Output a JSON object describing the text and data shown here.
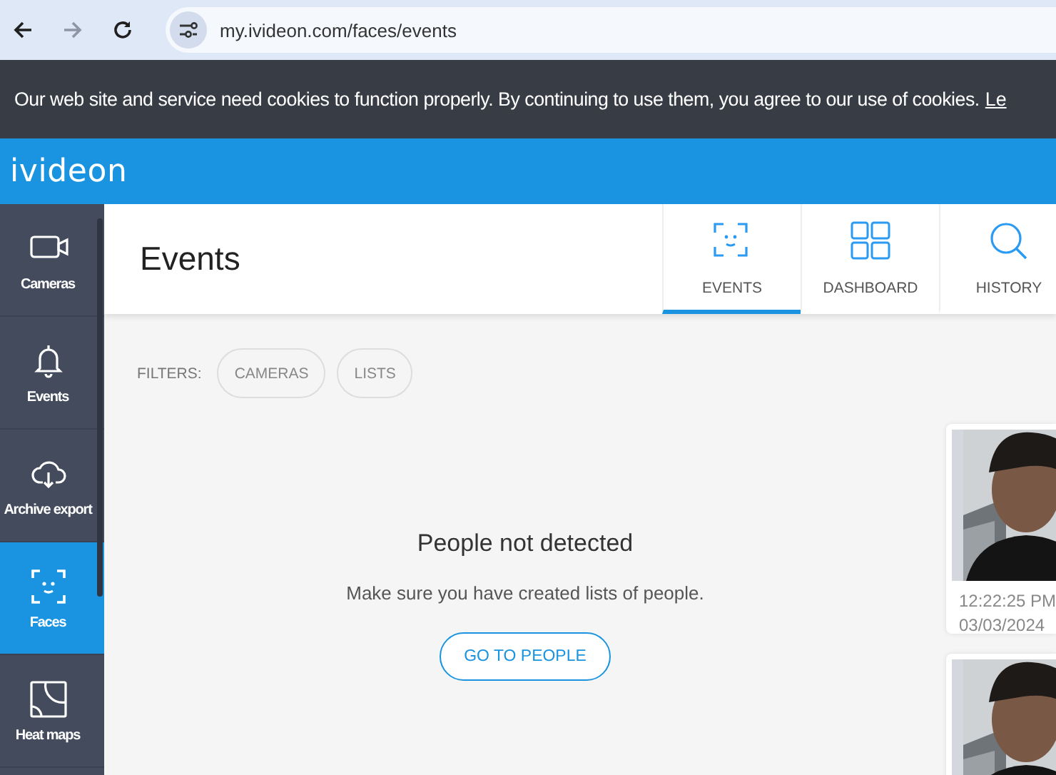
{
  "browser": {
    "url": "my.ivideon.com/faces/events",
    "back_disabled": false,
    "forward_disabled": true
  },
  "cookie_banner": {
    "text": "Our web site and service need cookies to function properly. By continuing to use them, you agree to our use of cookies.",
    "link": "Le"
  },
  "header": {
    "logo": "ivideon"
  },
  "sidebar": {
    "items": [
      {
        "label": "Cameras",
        "selected": false
      },
      {
        "label": "Events",
        "selected": false
      },
      {
        "label": "Archive export",
        "selected": false
      },
      {
        "label": "Faces",
        "selected": true
      },
      {
        "label": "Heat maps",
        "selected": false
      }
    ]
  },
  "page": {
    "title": "Events",
    "tabs": [
      {
        "label": "EVENTS",
        "selected": true
      },
      {
        "label": "DASHBOARD",
        "selected": false
      },
      {
        "label": "HISTORY",
        "selected": false
      }
    ],
    "filters": {
      "label": "FILTERS:",
      "chips": [
        "CAMERAS",
        "LISTS"
      ]
    },
    "empty_state": {
      "title": "People not detected",
      "message": "Make sure you have created lists of people.",
      "button": "GO TO PEOPLE"
    },
    "events": [
      {
        "kind": "picture",
        "time": "12:22:25 PM",
        "date": "03/03/2024"
      },
      {
        "kind": "picture"
      }
    ]
  }
}
